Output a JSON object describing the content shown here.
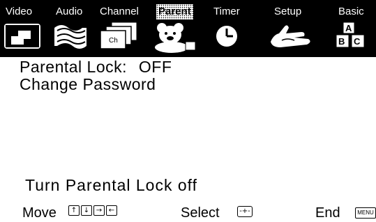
{
  "menu_bar": {
    "tabs": [
      {
        "label": "Video",
        "active": false
      },
      {
        "label": "Audio",
        "active": false
      },
      {
        "label": "Channel",
        "active": false
      },
      {
        "label": "Parent",
        "active": true
      },
      {
        "label": "Timer",
        "active": false
      },
      {
        "label": "Setup",
        "active": false
      },
      {
        "label": "Basic",
        "active": false
      }
    ],
    "icons": [
      "video-icon",
      "audio-wave-icon",
      "channel-icon",
      "teddy-bear-icon",
      "clock-icon",
      "setup-hand-icon",
      "abc-blocks-icon"
    ],
    "channel_icon_text": "Ch",
    "abc_icon_letters": [
      "A",
      "B",
      "C"
    ]
  },
  "menu": {
    "items": [
      {
        "label": "Parental Lock:",
        "value": "OFF"
      },
      {
        "label": "Change Password"
      }
    ]
  },
  "help_text": "Turn Parental Lock off",
  "footer": {
    "move_label": "Move",
    "move_keys": [
      "↑",
      "↓",
      "→",
      "←"
    ],
    "select_label": "Select",
    "select_key": "-+-",
    "end_label": "End",
    "end_key": "MENU"
  },
  "colors": {
    "bar": "#000000",
    "background": "#ffffff",
    "text": "#000000"
  }
}
